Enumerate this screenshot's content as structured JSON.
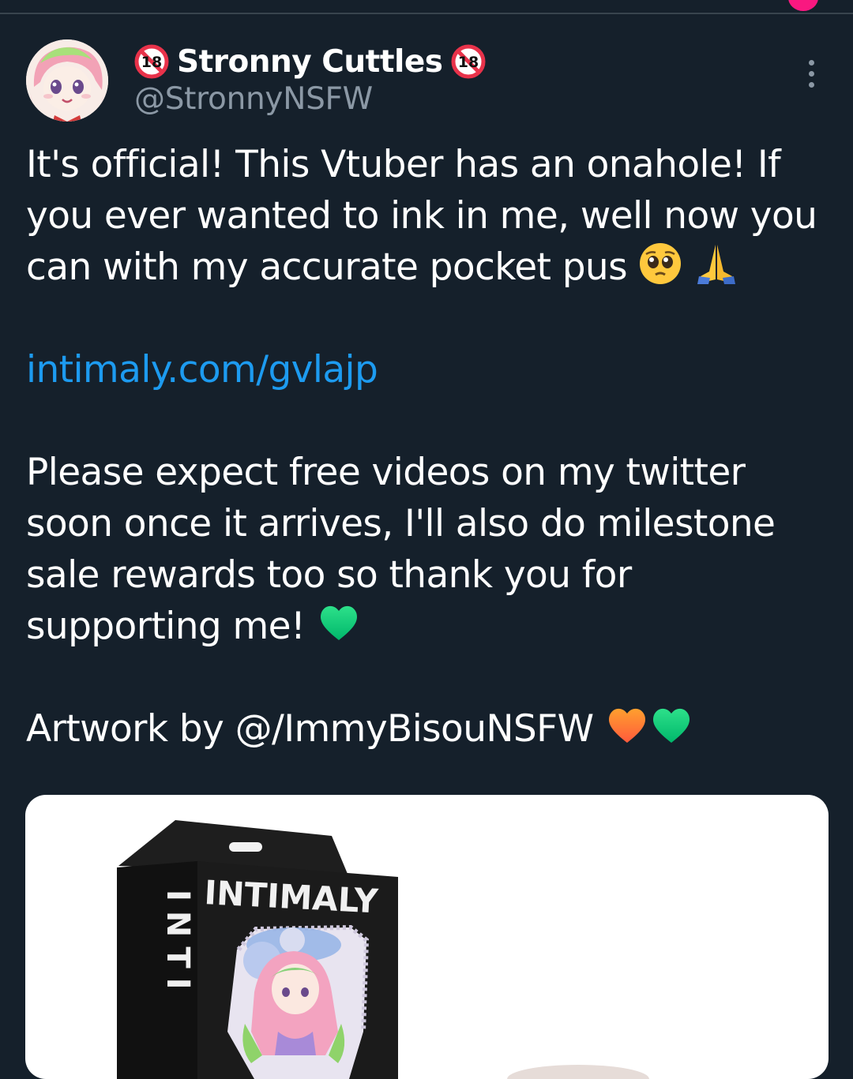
{
  "author": {
    "display_name": "Stronny Cuttles",
    "handle": "@StronnyNSFW",
    "badge": "18",
    "badge_icon": "no-under-18-icon",
    "more_icon": "more-options-icon"
  },
  "tweet": {
    "line1": "It's official! This Vtuber has an onahole! If you ever wanted to ink in me, well now you can with my accurate pocket pus",
    "line1_emojis": [
      "pleading-face-emoji",
      "folded-hands-emoji"
    ],
    "link": "intimaly.com/gvlajp",
    "line2": "Please expect free videos on my twitter soon once it arrives, I'll also do milestone sale rewards too so thank you for supporting me!",
    "line2_emoji": "green-heart-emoji",
    "line3": "Artwork by @/ImmyBisouNSFW",
    "line3_emojis": [
      "orange-heart-emoji",
      "green-heart-emoji"
    ]
  },
  "media": {
    "box_brand": "INTIMALY",
    "box_side_text": "INTI"
  },
  "colors": {
    "background": "#15202b",
    "text": "#ffffff",
    "secondary_text": "#8b98a5",
    "link": "#1d9bf0",
    "notification": "#f91880"
  }
}
